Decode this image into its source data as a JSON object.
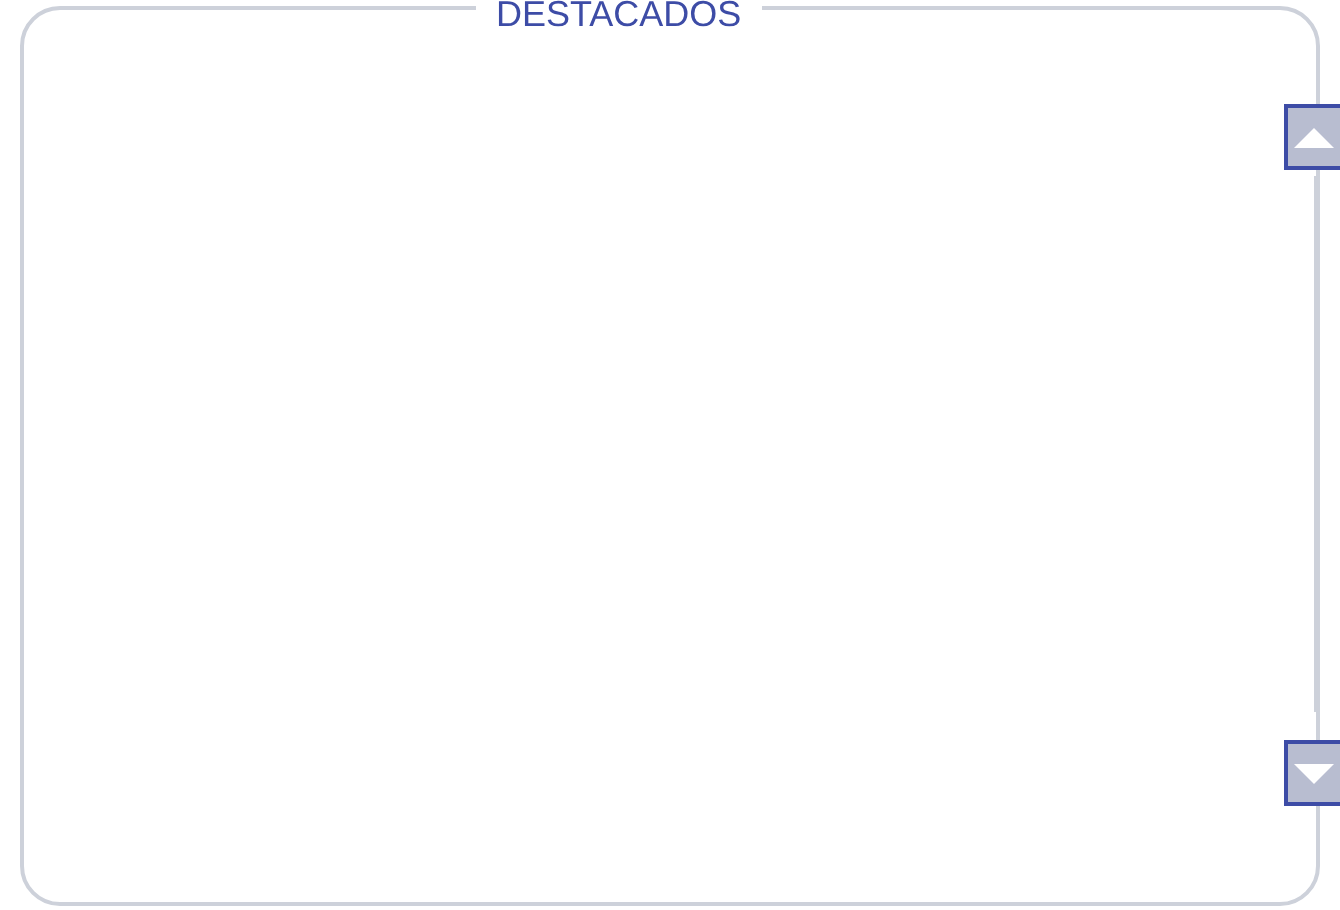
{
  "panel": {
    "title": "DESTACADOS"
  }
}
